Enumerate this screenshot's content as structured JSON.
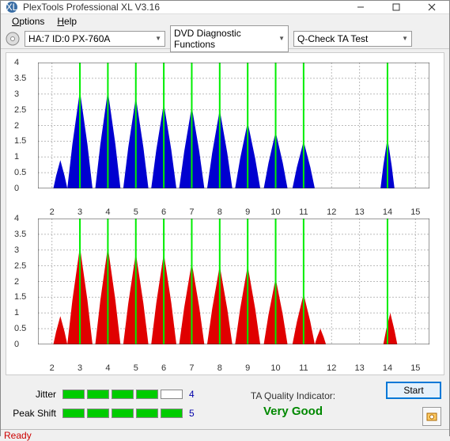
{
  "window": {
    "title": "PlexTools Professional XL V3.16"
  },
  "menu": {
    "options": "Options",
    "help": "Help"
  },
  "toolbar": {
    "device": "HA:7 ID:0  PX-760A",
    "func": "DVD Diagnostic Functions",
    "test": "Q-Check TA Test"
  },
  "bottom": {
    "jitter_label": "Jitter",
    "jitter_score": "4",
    "peakshift_label": "Peak Shift",
    "peakshift_score": "5",
    "ta_label": "TA Quality Indicator:",
    "ta_value": "Very Good",
    "start": "Start"
  },
  "status": {
    "text": "Ready"
  },
  "chart_data": [
    {
      "type": "bar",
      "color": "#0000d0",
      "xlim": [
        1.5,
        15.5
      ],
      "ylim": [
        0,
        4
      ],
      "yticks": [
        0,
        0.5,
        1,
        1.5,
        2,
        2.5,
        3,
        3.5,
        4
      ],
      "xticks": [
        2,
        3,
        4,
        5,
        6,
        7,
        8,
        9,
        10,
        11,
        12,
        13,
        14,
        15
      ],
      "green": [
        3,
        4,
        5,
        6,
        7,
        8,
        9,
        10,
        11,
        14
      ],
      "peaks": [
        {
          "c": 2.3,
          "h": 0.9,
          "w": 0.5
        },
        {
          "c": 3.0,
          "h": 3.1,
          "w": 0.9
        },
        {
          "c": 4.0,
          "h": 3.1,
          "w": 0.9
        },
        {
          "c": 5.0,
          "h": 2.9,
          "w": 0.9
        },
        {
          "c": 6.0,
          "h": 2.7,
          "w": 0.9
        },
        {
          "c": 7.0,
          "h": 2.6,
          "w": 0.9
        },
        {
          "c": 8.0,
          "h": 2.5,
          "w": 0.9
        },
        {
          "c": 9.0,
          "h": 2.1,
          "w": 0.9
        },
        {
          "c": 10.0,
          "h": 1.8,
          "w": 0.85
        },
        {
          "c": 11.0,
          "h": 1.5,
          "w": 0.8
        },
        {
          "c": 14.0,
          "h": 1.6,
          "w": 0.5
        }
      ]
    },
    {
      "type": "bar",
      "color": "#e00000",
      "xlim": [
        1.5,
        15.5
      ],
      "ylim": [
        0,
        4
      ],
      "yticks": [
        0,
        0.5,
        1,
        1.5,
        2,
        2.5,
        3,
        3.5,
        4
      ],
      "xticks": [
        2,
        3,
        4,
        5,
        6,
        7,
        8,
        9,
        10,
        11,
        12,
        13,
        14,
        15
      ],
      "green": [
        3,
        4,
        5,
        6,
        7,
        8,
        9,
        10,
        11,
        14
      ],
      "peaks": [
        {
          "c": 2.3,
          "h": 0.9,
          "w": 0.5
        },
        {
          "c": 3.0,
          "h": 3.1,
          "w": 0.9
        },
        {
          "c": 4.0,
          "h": 3.1,
          "w": 0.9
        },
        {
          "c": 5.0,
          "h": 2.9,
          "w": 0.9
        },
        {
          "c": 6.0,
          "h": 2.9,
          "w": 0.9
        },
        {
          "c": 7.0,
          "h": 2.6,
          "w": 0.9
        },
        {
          "c": 8.0,
          "h": 2.5,
          "w": 0.9
        },
        {
          "c": 9.0,
          "h": 2.5,
          "w": 0.9
        },
        {
          "c": 10.0,
          "h": 2.1,
          "w": 0.85
        },
        {
          "c": 11.0,
          "h": 1.6,
          "w": 0.8
        },
        {
          "c": 11.6,
          "h": 0.5,
          "w": 0.4
        },
        {
          "c": 14.1,
          "h": 1.0,
          "w": 0.5
        }
      ]
    }
  ]
}
